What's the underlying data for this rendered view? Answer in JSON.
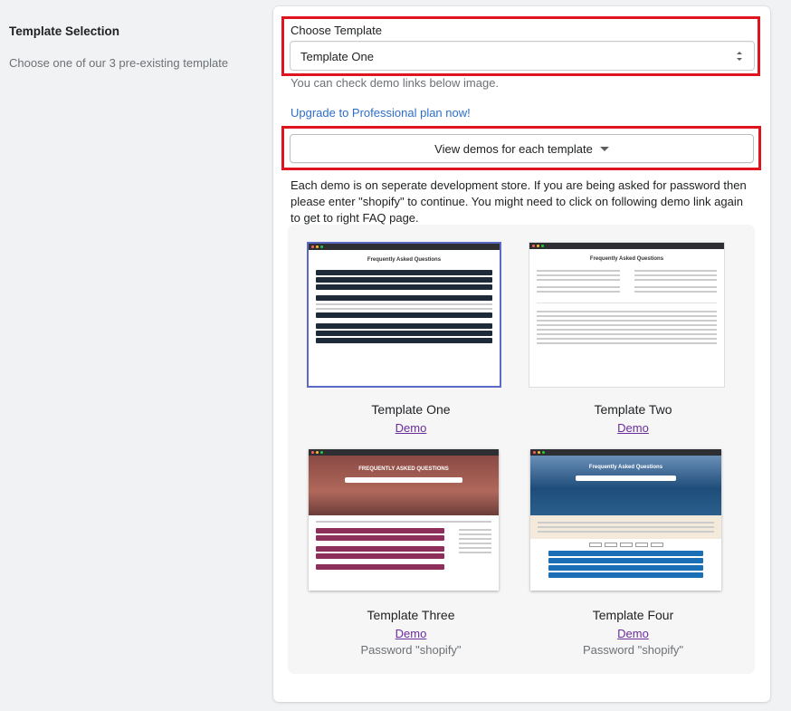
{
  "section": {
    "title": "Template Selection",
    "description": "Choose one of our 3 pre-existing template"
  },
  "template_select": {
    "label": "Choose Template",
    "value": "Template One"
  },
  "help_text": "You can check demo links below image.",
  "upgrade_link": "Upgrade to Professional plan now!",
  "demos_button": "View demos for each template",
  "note": "Each demo is on seperate development store. If you are being asked for password then please enter \"shopify\" to continue. You might need to click on following demo link again to get to right FAQ page.",
  "templates": [
    {
      "name": "Template One",
      "demo": "Demo",
      "thumb_title": "Frequently Asked Questions",
      "selected": true
    },
    {
      "name": "Template Two",
      "demo": "Demo",
      "thumb_title": "Frequently Asked Questions"
    },
    {
      "name": "Template Three",
      "demo": "Demo",
      "password": "Password \"shopify\"",
      "thumb_title": "FREQUENTLY ASKED QUESTIONS"
    },
    {
      "name": "Template Four",
      "demo": "Demo",
      "password": "Password \"shopify\"",
      "thumb_title": "Frequently Asked Questions"
    }
  ],
  "colors": {
    "highlight": "#e0141e",
    "link": "#2c6ecb",
    "visited_link": "#6b2c9c",
    "template_one_rows": "#1e2a38",
    "template_three_rows": "#8e2e5a",
    "template_four_rows": "#1b6fb6"
  },
  "icons": {
    "select_arrows": "chevron-up-down-icon",
    "button_caret": "caret-down-icon"
  }
}
